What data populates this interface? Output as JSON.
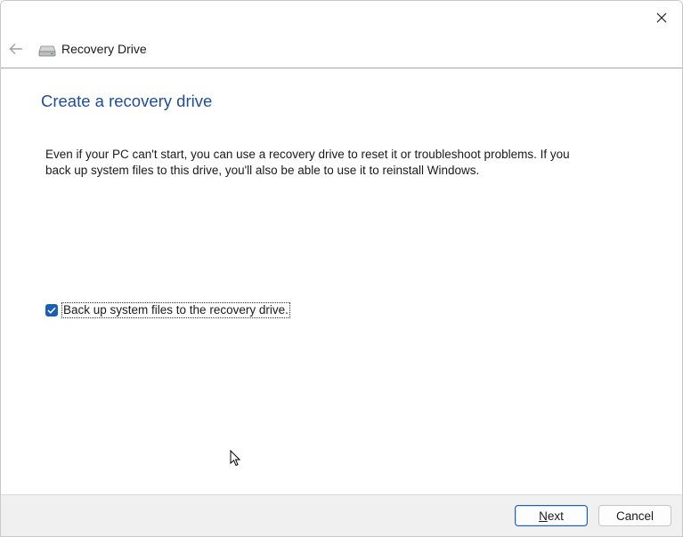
{
  "window": {
    "close_icon": "close-icon"
  },
  "navbar": {
    "back_icon": "back-arrow-icon",
    "drive_icon": "drive-icon",
    "title": "Recovery Drive"
  },
  "main": {
    "heading": "Create a recovery drive",
    "description": "Even if your PC can't start, you can use a recovery drive to reset it or troubleshoot problems. If you back up system files to this drive, you'll also be able to use it to reinstall Windows.",
    "backup_checkbox": {
      "label": "Back up system files to the recovery drive.",
      "checked": true
    }
  },
  "footer": {
    "next_label_mnemonic": "N",
    "next_label_rest": "ext",
    "cancel_label": "Cancel"
  },
  "colors": {
    "accent": "#1a5fb4",
    "heading": "#1e4e9a",
    "footer_bg": "#f0f0f0"
  }
}
